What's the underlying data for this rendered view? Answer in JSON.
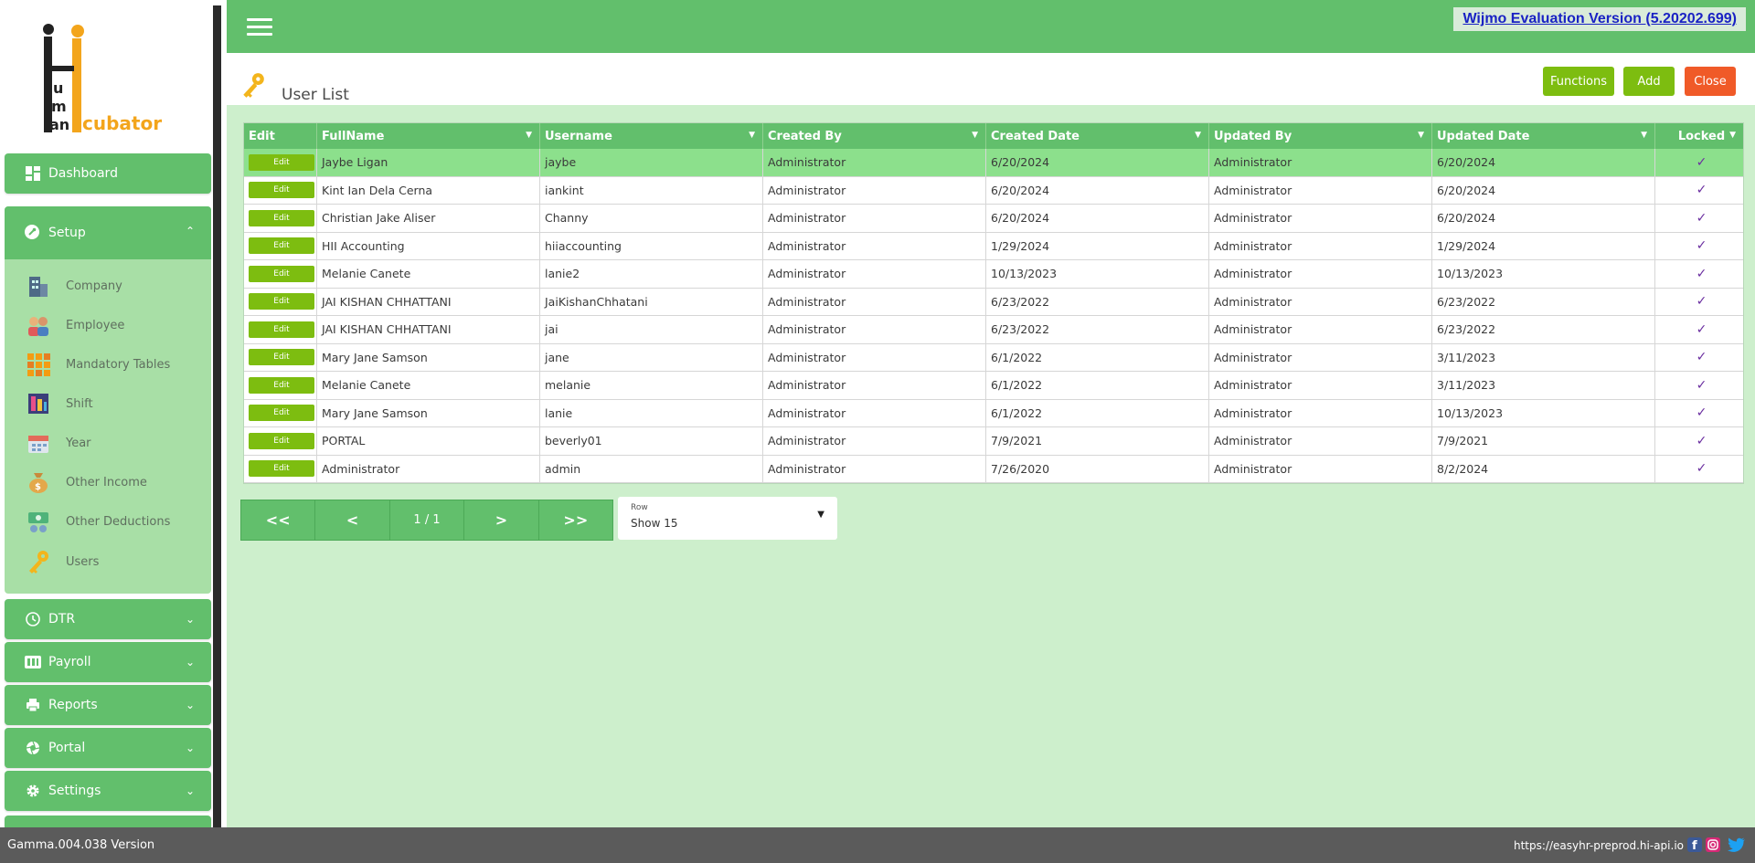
{
  "app": {
    "logo_text": "Hi Human Incubator",
    "evaluation_banner": "Wijmo Evaluation Version (5.20202.699)"
  },
  "sidebar": {
    "dashboard": "Dashboard",
    "setup": {
      "label": "Setup",
      "items": [
        {
          "label": "Company",
          "icon": "building-icon"
        },
        {
          "label": "Employee",
          "icon": "employee-icon"
        },
        {
          "label": "Mandatory Tables",
          "icon": "tables-icon"
        },
        {
          "label": "Shift",
          "icon": "shift-icon"
        },
        {
          "label": "Year",
          "icon": "calendar-icon"
        },
        {
          "label": "Other Income",
          "icon": "money-bag-icon"
        },
        {
          "label": "Other Deductions",
          "icon": "deductions-icon"
        },
        {
          "label": "Users",
          "icon": "key-icon"
        }
      ]
    },
    "dtr": "DTR",
    "payroll": "Payroll",
    "reports": "Reports",
    "portal": "Portal",
    "settings": "Settings"
  },
  "page": {
    "title": "User List",
    "buttons": {
      "functions": "Functions",
      "add": "Add",
      "close": "Close"
    }
  },
  "grid": {
    "columns": [
      "Edit",
      "FullName",
      "Username",
      "Created By",
      "Created Date",
      "Updated By",
      "Updated Date",
      "Locked"
    ],
    "edit_label": "Edit",
    "rows": [
      {
        "fullname": "Jaybe Ligan",
        "username": "jaybe",
        "created_by": "Administrator",
        "created_date": "6/20/2024",
        "updated_by": "Administrator",
        "updated_date": "6/20/2024",
        "locked": "✓"
      },
      {
        "fullname": "Kint Ian Dela Cerna",
        "username": "iankint",
        "created_by": "Administrator",
        "created_date": "6/20/2024",
        "updated_by": "Administrator",
        "updated_date": "6/20/2024",
        "locked": "✓"
      },
      {
        "fullname": "Christian Jake Aliser",
        "username": "Channy",
        "created_by": "Administrator",
        "created_date": "6/20/2024",
        "updated_by": "Administrator",
        "updated_date": "6/20/2024",
        "locked": "✓"
      },
      {
        "fullname": "HII Accounting",
        "username": "hiiaccounting",
        "created_by": "Administrator",
        "created_date": "1/29/2024",
        "updated_by": "Administrator",
        "updated_date": "1/29/2024",
        "locked": "✓"
      },
      {
        "fullname": "Melanie Canete",
        "username": "lanie2",
        "created_by": "Administrator",
        "created_date": "10/13/2023",
        "updated_by": "Administrator",
        "updated_date": "10/13/2023",
        "locked": "✓"
      },
      {
        "fullname": "JAI KISHAN CHHATTANI",
        "username": "JaiKishanChhatani",
        "created_by": "Administrator",
        "created_date": "6/23/2022",
        "updated_by": "Administrator",
        "updated_date": "6/23/2022",
        "locked": "✓"
      },
      {
        "fullname": "JAI KISHAN CHHATTANI",
        "username": "jai",
        "created_by": "Administrator",
        "created_date": "6/23/2022",
        "updated_by": "Administrator",
        "updated_date": "6/23/2022",
        "locked": "✓"
      },
      {
        "fullname": "Mary Jane Samson",
        "username": "jane",
        "created_by": "Administrator",
        "created_date": "6/1/2022",
        "updated_by": "Administrator",
        "updated_date": "3/11/2023",
        "locked": "✓"
      },
      {
        "fullname": "Melanie Canete",
        "username": "melanie",
        "created_by": "Administrator",
        "created_date": "6/1/2022",
        "updated_by": "Administrator",
        "updated_date": "3/11/2023",
        "locked": "✓"
      },
      {
        "fullname": "Mary Jane Samson",
        "username": "lanie",
        "created_by": "Administrator",
        "created_date": "6/1/2022",
        "updated_by": "Administrator",
        "updated_date": "10/13/2023",
        "locked": "✓"
      },
      {
        "fullname": "PORTAL",
        "username": "beverly01",
        "created_by": "Administrator",
        "created_date": "7/9/2021",
        "updated_by": "Administrator",
        "updated_date": "7/9/2021",
        "locked": "✓"
      },
      {
        "fullname": "Administrator",
        "username": "admin",
        "created_by": "Administrator",
        "created_date": "7/26/2020",
        "updated_by": "Administrator",
        "updated_date": "8/2/2024",
        "locked": "✓"
      }
    ]
  },
  "pager": {
    "first": "<<",
    "prev": "<",
    "info": "1 / 1",
    "next": ">",
    "last": ">>",
    "rows_label": "Row",
    "rows_value": "Show 15"
  },
  "footer": {
    "version": "Gamma.004.038 Version",
    "url": "https://easyhr-preprod.hi-api.io"
  },
  "colors": {
    "primary_green": "#62bf6c",
    "content_bg": "#cdefcc",
    "edit_button": "#7dbd10",
    "add_button": "#7dbd10",
    "close_button": "#f05a28",
    "selected_row": "#8ce08c",
    "footer": "#5b5b5b"
  }
}
